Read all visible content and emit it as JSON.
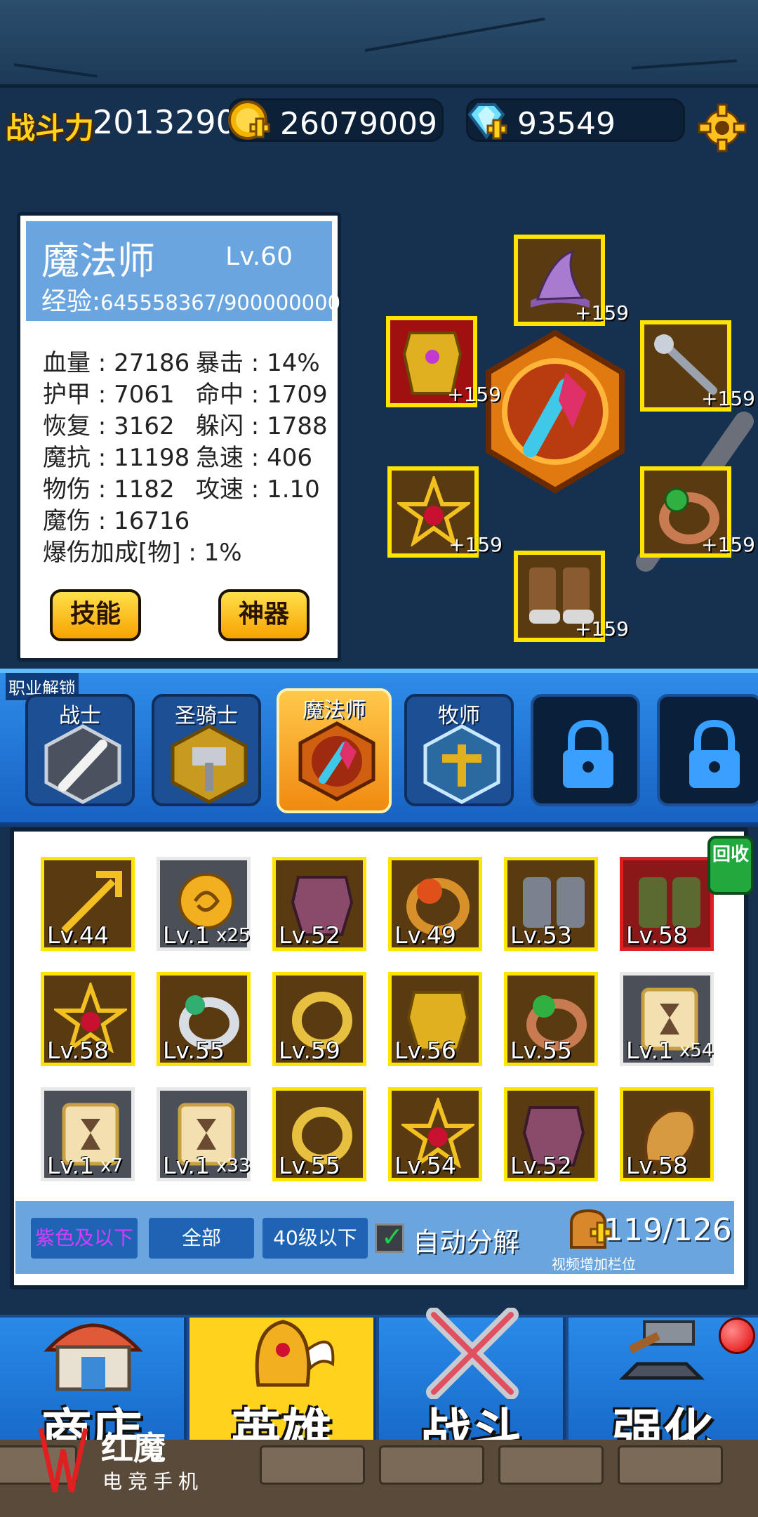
{
  "header": {
    "power_label": "战斗力",
    "power_value": "2013290",
    "gold": "26079009",
    "diamond": "93549"
  },
  "hero": {
    "name": "魔法师",
    "level": "Lv.60",
    "exp_label": "经验:",
    "exp_value": "645558367/900000000",
    "stats": [
      "血量 : 27186",
      "暴击 : 14%",
      "护甲 : 7061",
      "命中 : 1709",
      "恢复 : 3162",
      "躲闪 : 1788",
      "魔抗 : 11198",
      "急速 : 406",
      "物伤 : 1182",
      "攻速 : 1.10",
      "魔伤 : 16716",
      "爆伤加成[物] : 1%"
    ],
    "skill_button": "技能",
    "artifact_button": "神器"
  },
  "equipment": {
    "plus_labels": [
      "+159",
      "+159",
      "+159",
      "+159",
      "+159",
      "+159"
    ]
  },
  "classes": {
    "unlock_label": "职业解锁",
    "tabs": [
      "战士",
      "圣骑士",
      "魔法师",
      "牧师"
    ]
  },
  "inventory": {
    "recycle_label": "回收",
    "items": [
      {
        "lv": "Lv.44",
        "count": ""
      },
      {
        "lv": "Lv.1",
        "count": "x25"
      },
      {
        "lv": "Lv.52",
        "count": ""
      },
      {
        "lv": "Lv.49",
        "count": ""
      },
      {
        "lv": "Lv.53",
        "count": ""
      },
      {
        "lv": "Lv.58",
        "count": ""
      },
      {
        "lv": "Lv.58",
        "count": ""
      },
      {
        "lv": "Lv.55",
        "count": ""
      },
      {
        "lv": "Lv.59",
        "count": ""
      },
      {
        "lv": "Lv.56",
        "count": ""
      },
      {
        "lv": "Lv.55",
        "count": ""
      },
      {
        "lv": "Lv.1",
        "count": "x54"
      },
      {
        "lv": "Lv.1",
        "count": "x7"
      },
      {
        "lv": "Lv.1",
        "count": "x33"
      },
      {
        "lv": "Lv.55",
        "count": ""
      },
      {
        "lv": "Lv.54",
        "count": ""
      },
      {
        "lv": "Lv.52",
        "count": ""
      },
      {
        "lv": "Lv.58",
        "count": ""
      }
    ],
    "filter_purple": "紫色及以下",
    "filter_all": "全部",
    "filter_level": "40级以下",
    "auto_decompose": "自动分解",
    "bag_count": "119/126",
    "bag_hint": "视频增加栏位"
  },
  "nav": {
    "tabs": [
      "商店",
      "英雄",
      "战斗",
      "强化"
    ]
  },
  "watermark": {
    "title": "红魔",
    "subtitle": "电竞手机"
  },
  "colors": {
    "gold_border": "#ffe400",
    "panel_blue": "#6aa5e0",
    "nav_selected": "#ffd21e"
  }
}
